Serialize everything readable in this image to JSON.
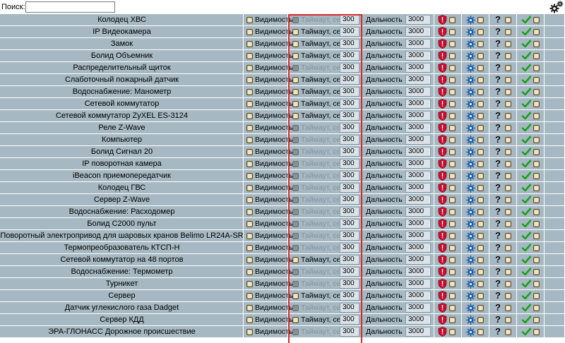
{
  "search": {
    "label": "Поиск:",
    "value": "",
    "placeholder": ""
  },
  "labels": {
    "visibility": "Видимость",
    "timeout": "Таймаут, сек",
    "distance": "Дальность",
    "question": "?"
  },
  "colors": {
    "row_bg": "#a6b8c2",
    "highlight": "#d62828",
    "shield": "#c8102e",
    "check": "#1aa01a",
    "gear": "#1f5fa8"
  },
  "rows": [
    {
      "name": "Колодец ХВС",
      "timeout_enabled": false,
      "timeout": "300",
      "distance": "3000"
    },
    {
      "name": "IP Видеокамера",
      "timeout_enabled": true,
      "timeout": "300",
      "distance": "3000"
    },
    {
      "name": "Замок",
      "timeout_enabled": true,
      "timeout": "300",
      "distance": "3000"
    },
    {
      "name": "Болид Объемник",
      "timeout_enabled": true,
      "timeout": "300",
      "distance": "3000"
    },
    {
      "name": "Распределительный щиток",
      "timeout_enabled": false,
      "timeout": "300",
      "distance": "3000"
    },
    {
      "name": "Слаботочный пожарный датчик",
      "timeout_enabled": true,
      "timeout": "300",
      "distance": "3000"
    },
    {
      "name": "Водоснабжение: Манометр",
      "timeout_enabled": true,
      "timeout": "300",
      "distance": "3000"
    },
    {
      "name": "Сетевой коммутатор",
      "timeout_enabled": true,
      "timeout": "300",
      "distance": "3000"
    },
    {
      "name": "Сетевой коммутатор ZyXEL ES-3124",
      "timeout_enabled": true,
      "timeout": "300",
      "distance": "3000"
    },
    {
      "name": "Реле Z-Wave",
      "timeout_enabled": false,
      "timeout": "300",
      "distance": "3000"
    },
    {
      "name": "Компьютер",
      "timeout_enabled": false,
      "timeout": "300",
      "distance": "3000"
    },
    {
      "name": "Болид Сигнал 20",
      "timeout_enabled": false,
      "timeout": "300",
      "distance": "3000"
    },
    {
      "name": "IP поворотная камера",
      "timeout_enabled": false,
      "timeout": "300",
      "distance": "3000"
    },
    {
      "name": "iBeacon приемопередатчик",
      "timeout_enabled": false,
      "timeout": "300",
      "distance": "3000"
    },
    {
      "name": "Колодец ГВС",
      "timeout_enabled": false,
      "timeout": "300",
      "distance": "3000"
    },
    {
      "name": "Сервер Z-Wave",
      "timeout_enabled": false,
      "timeout": "300",
      "distance": "3000"
    },
    {
      "name": "Водоснабжение: Расходомер",
      "timeout_enabled": false,
      "timeout": "300",
      "distance": "3000"
    },
    {
      "name": "Болид С2000 пульт",
      "timeout_enabled": false,
      "timeout": "300",
      "distance": "3000"
    },
    {
      "name": "Поворотный электропривод для шаровых кранов Belimo LR24A-SR",
      "timeout_enabled": false,
      "timeout": "300",
      "distance": "3000"
    },
    {
      "name": "Термопреобразователь КТСП-Н",
      "timeout_enabled": false,
      "timeout": "300",
      "distance": "3000"
    },
    {
      "name": "Сетевой коммутатор на 48 портов",
      "timeout_enabled": true,
      "timeout": "300",
      "distance": "3000"
    },
    {
      "name": "Водоснабжение: Термометр",
      "timeout_enabled": false,
      "timeout": "300",
      "distance": "3000"
    },
    {
      "name": "Турникет",
      "timeout_enabled": false,
      "timeout": "300",
      "distance": "3000"
    },
    {
      "name": "Сервер",
      "timeout_enabled": true,
      "timeout": "300",
      "distance": "3000"
    },
    {
      "name": "Датчик углекислого газа Dadget",
      "timeout_enabled": false,
      "timeout": "300",
      "distance": "3000"
    },
    {
      "name": "Сервер КДД",
      "timeout_enabled": true,
      "timeout": "300",
      "distance": "3000"
    },
    {
      "name": "ЭРА-ГЛОНАСС Дорожное происшествие",
      "timeout_enabled": false,
      "timeout": "300",
      "distance": "3000"
    }
  ]
}
